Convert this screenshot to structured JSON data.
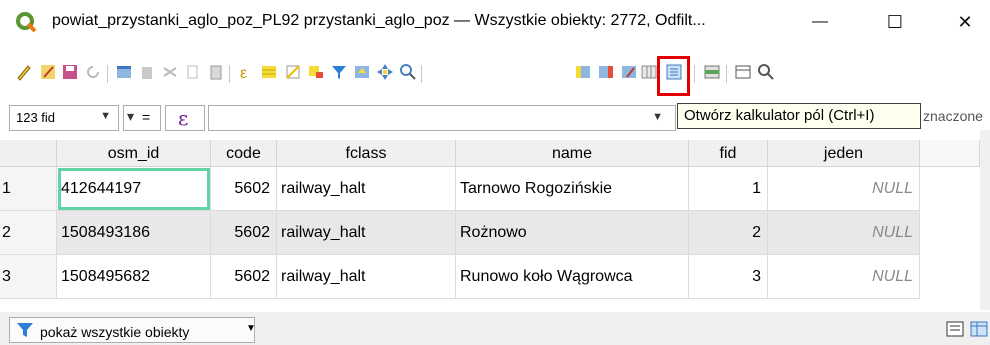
{
  "window": {
    "title": "powiat_przystanki_aglo_poz_PL92 przystanki_aglo_poz — Wszystkie obiekty: 2772, Odfilt...",
    "minimize_glyph": "—",
    "maximize_glyph": "☐",
    "close_glyph": "✕"
  },
  "tooltip": {
    "text": "Otwórz kalkulator pól (Ctrl+I)"
  },
  "filter": {
    "field_combo_value": "123 fid",
    "operator": "=",
    "expression_glyph": "ε",
    "clipped_text": "znaczone"
  },
  "table": {
    "columns": [
      "osm_id",
      "code",
      "fclass",
      "name",
      "fid",
      "jeden"
    ],
    "rows": [
      {
        "num": "1",
        "osm_id": "412644197",
        "code": "5602",
        "fclass": "railway_halt",
        "name": "Tarnowo Rogozińskie",
        "fid": "1",
        "jeden": "NULL"
      },
      {
        "num": "2",
        "osm_id": "1508493186",
        "code": "5602",
        "fclass": "railway_halt",
        "name": "Rożnowo",
        "fid": "2",
        "jeden": "NULL"
      },
      {
        "num": "3",
        "osm_id": "1508495682",
        "code": "5602",
        "fclass": "railway_halt",
        "name": "Runowo koło Wągrowca",
        "fid": "3",
        "jeden": "NULL"
      }
    ]
  },
  "bottom": {
    "show_all_label": "pokaż wszystkie obiekty"
  },
  "colors": {
    "highlight": "#e00000",
    "selected_cell": "#62d3a5",
    "null_text": "#8a8a8a"
  }
}
